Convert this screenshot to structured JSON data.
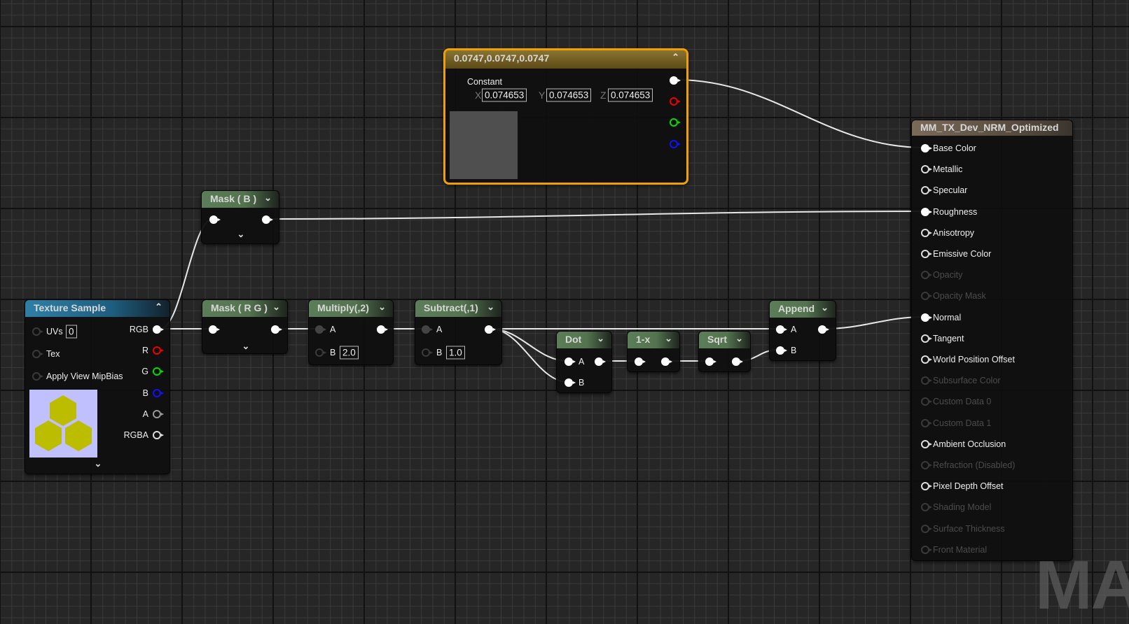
{
  "colors": {
    "wire": "#e8e8e8",
    "selected_outline": "#f0a000",
    "pin_r": "#e00000",
    "pin_g": "#00d000",
    "pin_b": "#1010ff",
    "constant_preview": "#4f4f4f",
    "texture_bg": "#c0c0ff",
    "texture_hex": "#bdbd00"
  },
  "constant": {
    "title": "0.0747,0.0747,0.0747",
    "label": "Constant",
    "x_label": "X",
    "y_label": "Y",
    "z_label": "Z",
    "x": "0.074653",
    "y": "0.074653",
    "z": "0.074653",
    "collapse_icon": "chevron-up"
  },
  "texture_sample": {
    "title": "Texture Sample",
    "inputs": [
      {
        "label": "UVs",
        "value": "0"
      },
      {
        "label": "Tex"
      },
      {
        "label": "Apply View MipBias"
      }
    ],
    "outputs": [
      "RGB",
      "R",
      "G",
      "B",
      "A",
      "RGBA"
    ]
  },
  "mask_b": {
    "title": "Mask ( B )"
  },
  "mask_rg": {
    "title": "Mask ( R G )"
  },
  "multiply": {
    "title": "Multiply(,2)",
    "a": "A",
    "b": "B",
    "b_value": "2.0"
  },
  "subtract": {
    "title": "Subtract(,1)",
    "a": "A",
    "b": "B",
    "b_value": "1.0"
  },
  "dot": {
    "title": "Dot",
    "a": "A",
    "b": "B"
  },
  "one_minus": {
    "title": "1-x"
  },
  "sqrt": {
    "title": "Sqrt"
  },
  "append": {
    "title": "Append",
    "a": "A",
    "b": "B"
  },
  "material": {
    "title": "MM_TX_Dev_NRM_Optimized",
    "pins": [
      {
        "label": "Base Color",
        "state": "connected"
      },
      {
        "label": "Metallic",
        "state": "enabled"
      },
      {
        "label": "Specular",
        "state": "enabled"
      },
      {
        "label": "Roughness",
        "state": "connected"
      },
      {
        "label": "Anisotropy",
        "state": "enabled"
      },
      {
        "label": "Emissive Color",
        "state": "enabled"
      },
      {
        "label": "Opacity",
        "state": "disabled"
      },
      {
        "label": "Opacity Mask",
        "state": "disabled"
      },
      {
        "label": "Normal",
        "state": "connected"
      },
      {
        "label": "Tangent",
        "state": "enabled"
      },
      {
        "label": "World Position Offset",
        "state": "enabled"
      },
      {
        "label": "Subsurface Color",
        "state": "disabled"
      },
      {
        "label": "Custom Data 0",
        "state": "disabled"
      },
      {
        "label": "Custom Data 1",
        "state": "disabled"
      },
      {
        "label": "Ambient Occlusion",
        "state": "enabled"
      },
      {
        "label": "Refraction (Disabled)",
        "state": "disabled"
      },
      {
        "label": "Pixel Depth Offset",
        "state": "enabled"
      },
      {
        "label": "Shading Model",
        "state": "disabled"
      },
      {
        "label": "Surface Thickness",
        "state": "disabled"
      },
      {
        "label": "Front Material",
        "state": "disabled"
      }
    ]
  },
  "watermark": "MAT"
}
